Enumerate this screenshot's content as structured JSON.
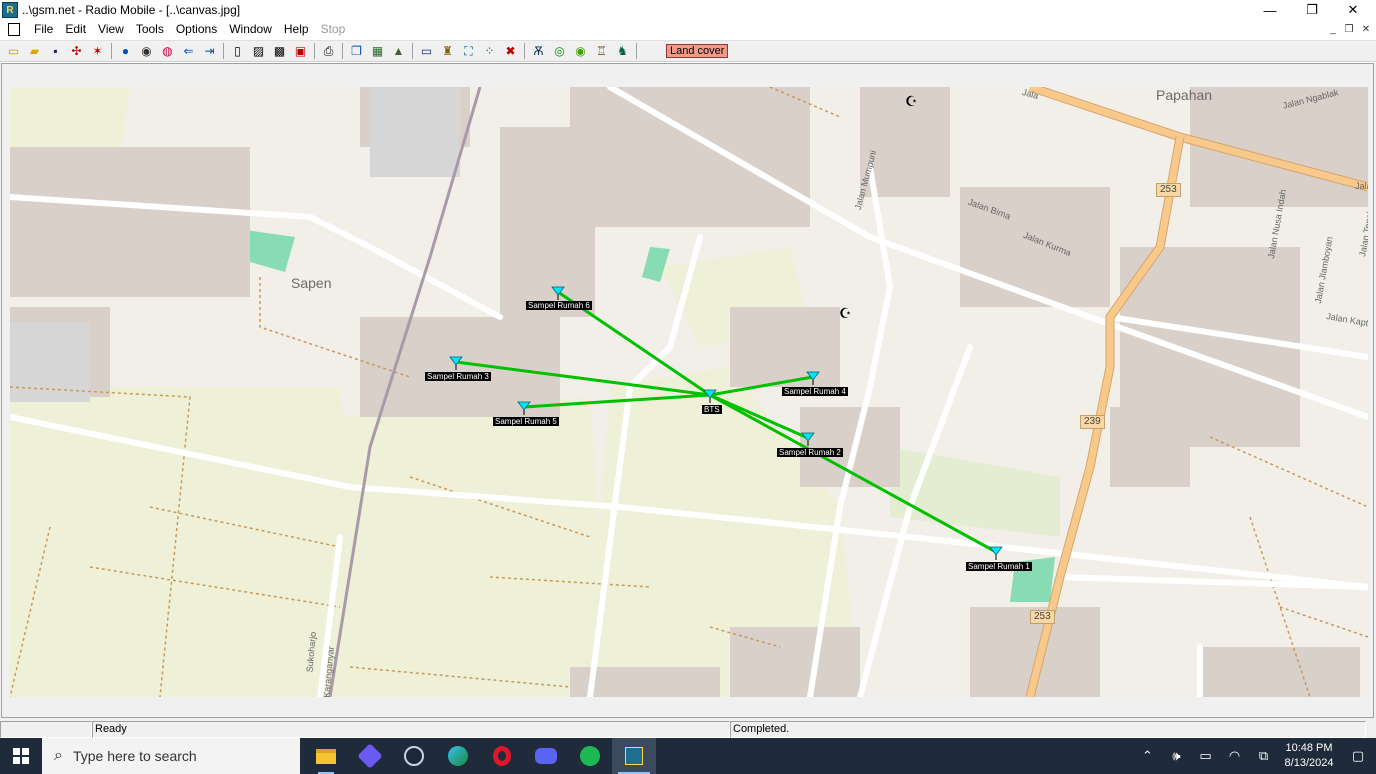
{
  "window": {
    "title": "..\\gsm.net - Radio Mobile - [..\\canvas.jpg]",
    "minimize_glyph": "—",
    "maximize_glyph": "❐",
    "close_glyph": "✕"
  },
  "menu": {
    "items": [
      "File",
      "Edit",
      "View",
      "Tools",
      "Options",
      "Window",
      "Help"
    ],
    "stop": "Stop"
  },
  "toolbar": {
    "land_cover": "Land cover",
    "icons": [
      "new-icon",
      "open-icon",
      "save-icon",
      "net-properties-icon",
      "radio-link-icon",
      "world-icon",
      "map-icon",
      "satellite-icon",
      "back-icon",
      "forward-icon",
      "page-icon",
      "page-copy-icon",
      "page-paste-icon",
      "delete-icon",
      "print-icon",
      "copy-icon",
      "radio-coverage-icon",
      "terrain-icon",
      "window-icon",
      "units-icon",
      "fit-icon",
      "nodes-icon",
      "close-map-icon",
      "antenna-icon",
      "coverage-green-icon",
      "earth-icon",
      "elevation-icon",
      "route-icon"
    ]
  },
  "map": {
    "places": [
      {
        "name": "Papahan"
      },
      {
        "name": "Sapen"
      }
    ],
    "streets": [
      "Jalan Ngablak",
      "Jalan Mumpuni",
      "Jalan Bima",
      "Jalan Kurma",
      "Jalan Nusa Indah",
      "Jalan Tegalarum",
      "Jalan Jlamboyan",
      "Jalan Kapte",
      "Jala",
      "Sukoharjo",
      "Karanganyar",
      "Jala"
    ],
    "shields": [
      "253",
      "239",
      "253"
    ],
    "hub": {
      "label": "BTS"
    },
    "sites": [
      {
        "label": "Sampel Rumah 6"
      },
      {
        "label": "Sampel Rumah 3"
      },
      {
        "label": "Sampel Rumah 5"
      },
      {
        "label": "Sampel Rumah 4"
      },
      {
        "label": "Sampel Rumah 2"
      },
      {
        "label": "Sampel Rumah 1"
      }
    ],
    "link_color": "#00c000",
    "marker_color": "#00e5ff"
  },
  "status": {
    "pane1": "",
    "pane2": "Ready",
    "pane3": "Completed."
  },
  "taskbar": {
    "search_placeholder": "Type here to search",
    "apps": [
      "file-explorer-icon",
      "copilot-icon",
      "steam-icon",
      "edge-icon",
      "opera-icon",
      "discord-icon",
      "spotify-icon",
      "radio-mobile-icon"
    ],
    "time": "10:48 PM",
    "date": "8/13/2024"
  }
}
